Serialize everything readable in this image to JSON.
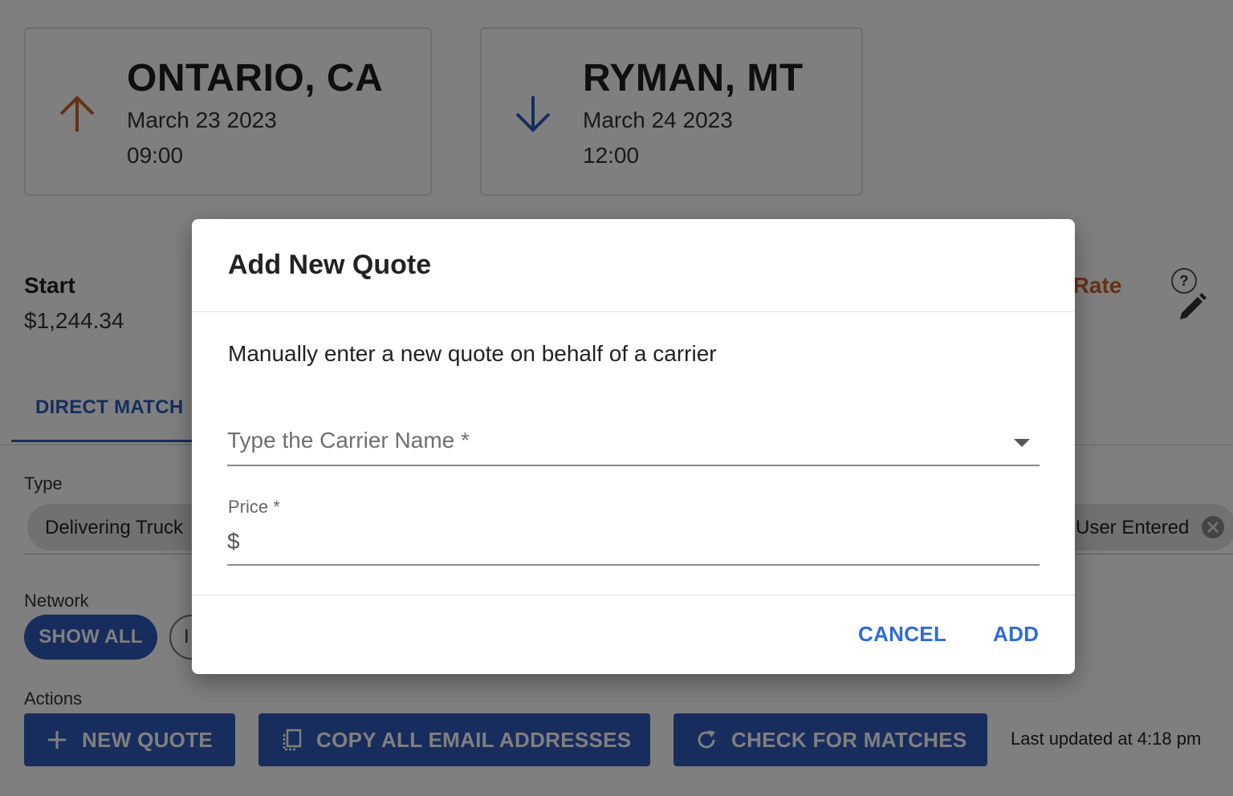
{
  "origin": {
    "city": "ONTARIO, CA",
    "date": "March 23 2023",
    "time": "09:00",
    "arrow_icon": "arrow-up-icon",
    "color": "#c8622a"
  },
  "destination": {
    "city": "RYMAN, MT",
    "date": "March 24 2023",
    "time": "12:00",
    "arrow_icon": "arrow-down-icon",
    "color": "#2e5bba"
  },
  "rates": {
    "start_label": "Start",
    "start_value": "$1,244.34",
    "rate_label": "ow Rate",
    "help_text": "?"
  },
  "tabs": {
    "direct_match": "DIRECT MATCH"
  },
  "filters": {
    "type_label": "Type",
    "type_chip": "Delivering Truck",
    "user_chip": "User Entered",
    "network_label": "Network",
    "show_all": "SHOW ALL",
    "network_chip2": "I"
  },
  "actions": {
    "label": "Actions",
    "new_quote": "NEW QUOTE",
    "copy_emails": "COPY ALL EMAIL ADDRESSES",
    "check_matches": "CHECK FOR MATCHES",
    "last_updated": "Last updated at 4:18 pm"
  },
  "dialog": {
    "title": "Add New Quote",
    "description": "Manually enter a new quote on behalf of a carrier",
    "carrier_placeholder": "Type the Carrier Name *",
    "price_label": "Price *",
    "price_prefix": "$",
    "cancel": "CANCEL",
    "add": "ADD"
  },
  "colors": {
    "primary": "#2e5bba",
    "accent": "#c8622a",
    "link": "#2e6bd8"
  }
}
